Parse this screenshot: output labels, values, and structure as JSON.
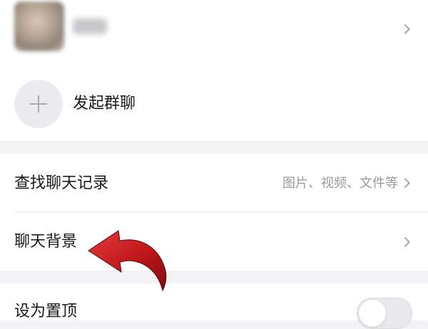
{
  "members": {
    "add_label": "发起群聊"
  },
  "records": {
    "find_label": "查找聊天记录",
    "find_value": "图片、视频、文件等",
    "background_label": "聊天背景"
  },
  "pin": {
    "label": "设为置顶",
    "enabled": false
  },
  "colors": {
    "annotation_arrow": "#c0171a",
    "page_background": "#f3f3f6"
  }
}
